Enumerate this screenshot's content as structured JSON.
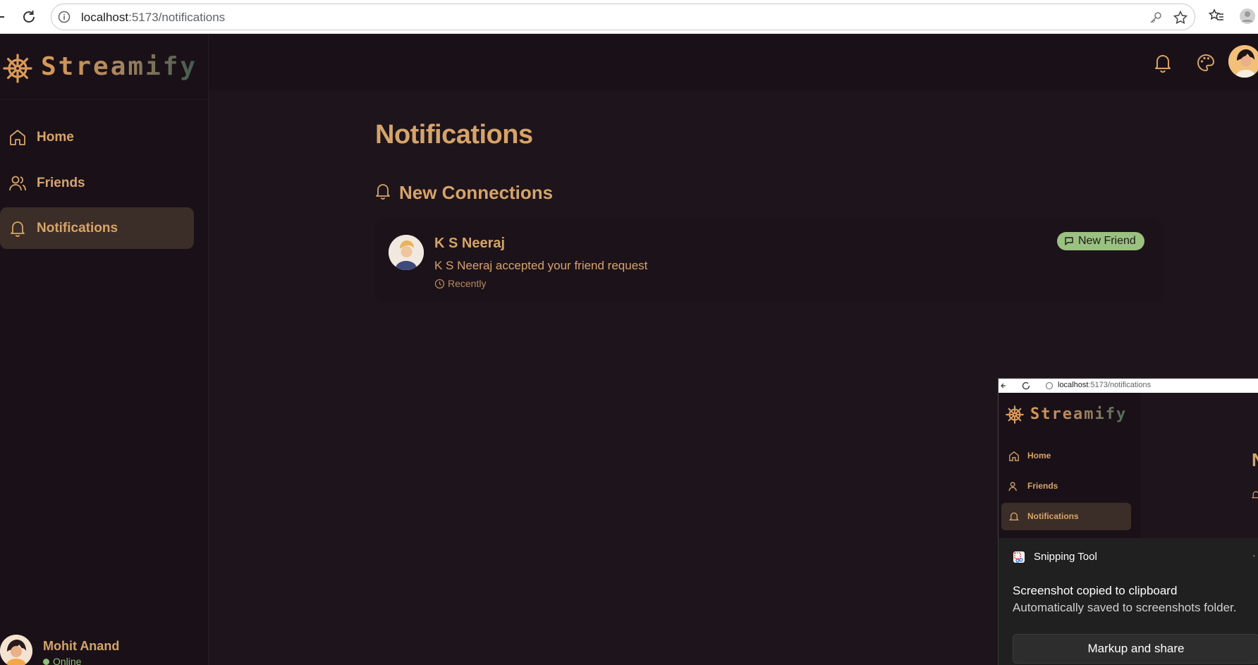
{
  "browser": {
    "url_host": "localhost",
    "url_path": ":5173/notifications"
  },
  "app": {
    "logo_text": "Streamify",
    "colors": {
      "accent": "#d6a468",
      "bg": "#1e141c",
      "sidebar_bg": "#1a1118",
      "active_bg": "#3b2d27",
      "badge_bg": "#9bc181",
      "online": "#8fbf7a"
    }
  },
  "sidebar": {
    "items": [
      {
        "label": "Home",
        "icon": "home-icon"
      },
      {
        "label": "Friends",
        "icon": "users-icon"
      },
      {
        "label": "Notifications",
        "icon": "bell-icon",
        "active": true
      }
    ],
    "user": {
      "name": "Mohit Anand",
      "status": "Online"
    }
  },
  "topbar": {
    "icons": [
      "bell-icon",
      "palette-icon",
      "avatar"
    ]
  },
  "main": {
    "title": "Notifications",
    "section_title": "New Connections",
    "notifications": [
      {
        "name": "K S Neeraj",
        "message": "K S Neeraj accepted your friend request",
        "time": "Recently",
        "badge": "New Friend"
      }
    ]
  },
  "snip_preview": {
    "url_host": "localhost",
    "url_path": ":5173/notifications",
    "logo_text": "Streamify",
    "nav": [
      "Home",
      "Friends",
      "Notifications"
    ],
    "partial_title": "N"
  },
  "toast": {
    "app_name": "Snipping Tool",
    "title": "Screenshot copied to clipboard",
    "body": "Automatically saved to screenshots folder.",
    "button": "Markup and share"
  }
}
